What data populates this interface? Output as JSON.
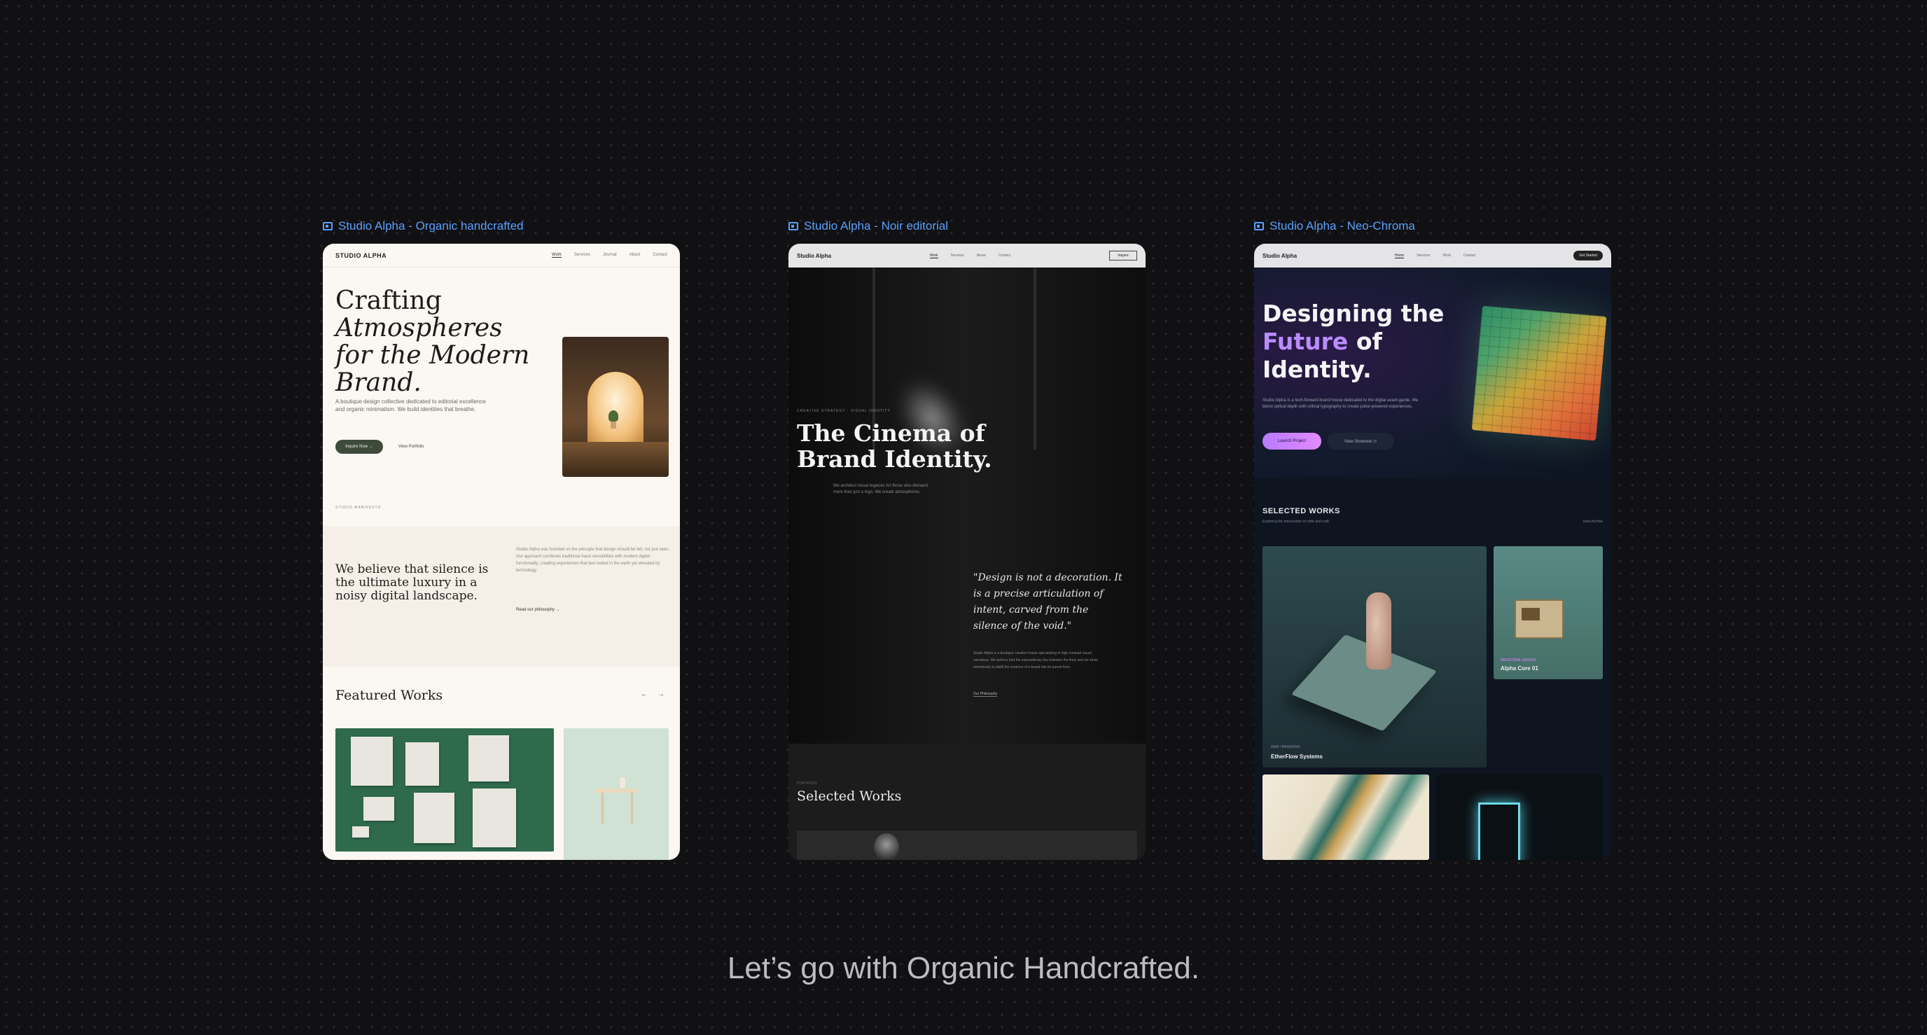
{
  "frames": [
    {
      "label": "Studio Alpha - Organic handcrafted"
    },
    {
      "label": "Studio Alpha - Noir editorial"
    },
    {
      "label": "Studio Alpha - Neo-Chroma"
    }
  ],
  "organic": {
    "logo": "STUDIO ALPHA",
    "nav": [
      "Work",
      "Services",
      "Journal",
      "About",
      "Contact"
    ],
    "hero_line1": "Crafting",
    "hero_line2": "Atmospheres",
    "hero_line3": "for the Modern",
    "hero_line4": "Brand.",
    "hero_sub": "A boutique design collective dedicated to editorial excellence and organic minimalism. We build identities that breathe.",
    "btn_primary": "Inquire Now →",
    "btn_secondary": "View Portfolio",
    "kicker": "STUDIO MANIFESTO",
    "quote": "We believe that silence is the ultimate luxury in a noisy digital landscape.",
    "body": "Studio Alpha was founded on the principle that design should be felt, not just seen. Our approach combines traditional hand-sensibilities with modern digital functionality, creating experiences that feel rooted in the earth yet elevated by technology.",
    "read_more": "Read our philosophy →",
    "featured_title": "Featured Works",
    "arrow_prev": "←",
    "arrow_next": "→"
  },
  "noir": {
    "logo": "Studio Alpha",
    "nav": [
      "Work",
      "Services",
      "About",
      "Contact"
    ],
    "cta": "Inquire",
    "kicker": "CREATIVE STRATEGY · VISUAL IDENTITY",
    "hero_title": "The Cinema of Brand Identity.",
    "hero_sub": "We architect visual legacies for those who demand more than just a logo. We create atmospheres.",
    "quote": "\"Design is not a decoration. It is a precise articulation of intent, carved from the silence of the void.\"",
    "quote_body": "Studio Alpha is a boutique creative house specializing in high-contrast visual narratives. We believe that the extraordinary lies between the lines and we strive relentlessly to distill the essence of a brand into its purest form.",
    "link": "Our Philosophy",
    "works_kicker": "PORTFOLIO",
    "works_title": "Selected Works"
  },
  "neo": {
    "logo": "Studio Alpha",
    "nav": [
      "Home",
      "Services",
      "Work",
      "Contact"
    ],
    "cta": "Get Started",
    "hero_pre": "Designing the",
    "hero_accent": "Future",
    "hero_of": " of",
    "hero_post": "Identity.",
    "hero_sub": "Studio Alpha is a tech-forward brand house dedicated to the digital avant-garde. We blend optical depth with critical typography to create pulse-powered experiences.",
    "btn_primary": "Launch Project",
    "btn_secondary": "View Showreel ⊙",
    "selected": "SELECTED WORKS",
    "selected_sub": "Exploring the intersection of code and craft",
    "view_archive": "View Archive",
    "card1_kicker": "WEB / BRANDING",
    "card1_title": "EtherFlow Systems",
    "card2_kicker": "INDUSTRIAL DESIGN",
    "card2_title": "Alpha Core 01"
  },
  "caption": "Let’s go with Organic Handcrafted.",
  "colors": {
    "label_blue": "#5aa0ff",
    "neo_accent": "#b98cff",
    "organic_green": "#2f6a4d"
  }
}
